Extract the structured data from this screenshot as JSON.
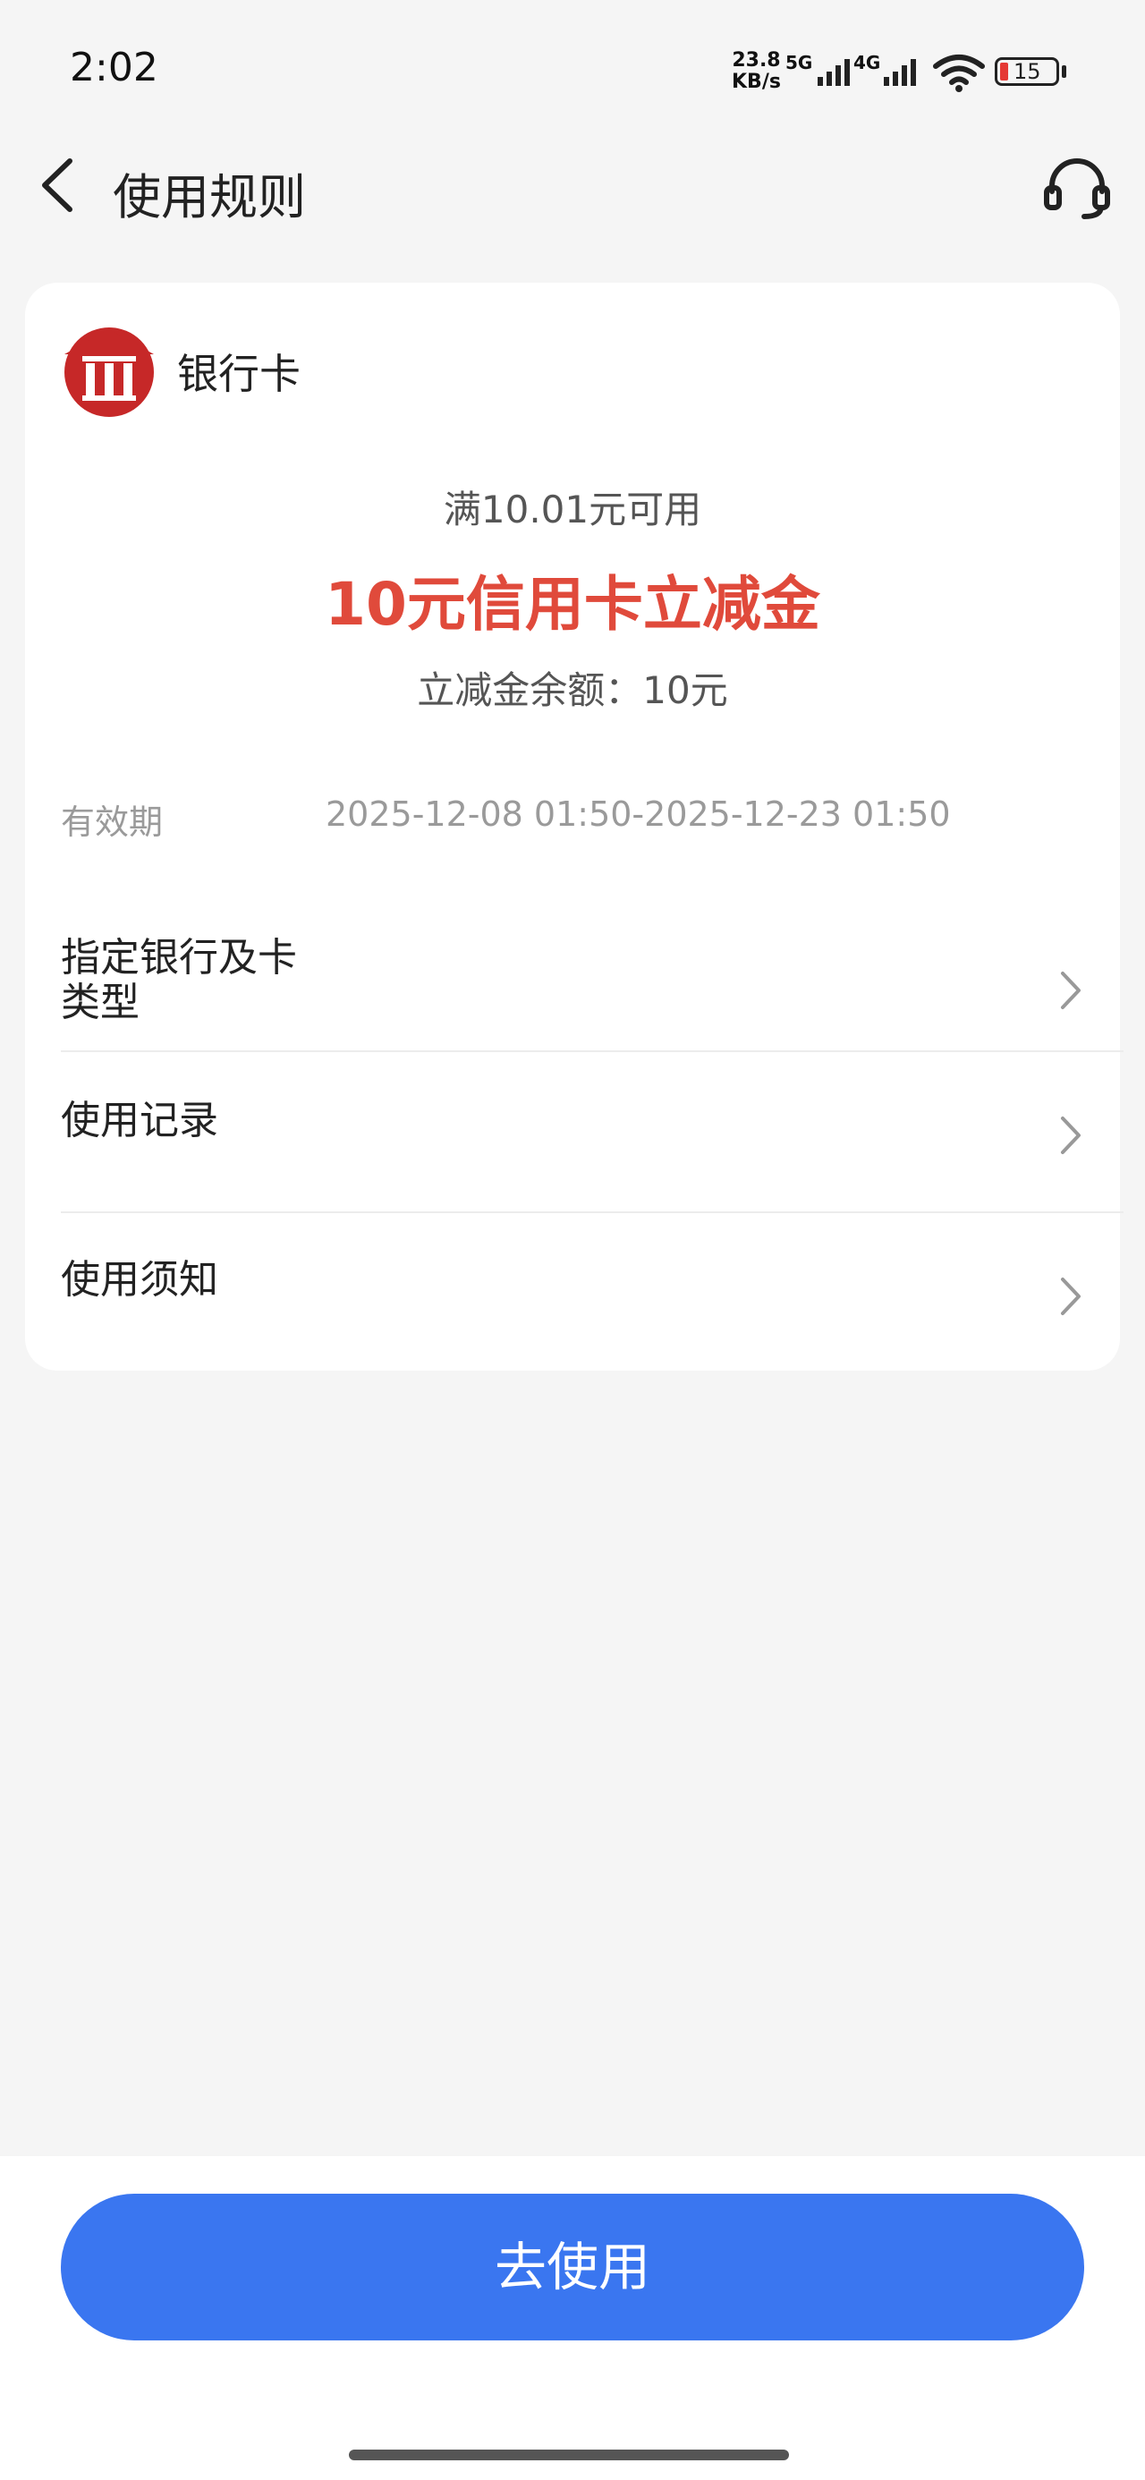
{
  "status_bar": {
    "time": "2:02",
    "net_speed_value": "23.8",
    "net_speed_unit": "KB/s",
    "signal1_tag": "5G",
    "signal2_tag": "4G",
    "battery_level": "15",
    "battery_color": "#e53935"
  },
  "nav": {
    "title": "使用规则",
    "back_icon": "chevron-left-icon",
    "support_icon": "headset-icon"
  },
  "card": {
    "bank_name": "银行卡",
    "bank_logo_color": "#c62828",
    "threshold": "满10.01元可用",
    "coupon_title": "10元信用卡立减金",
    "coupon_title_color": "#e04a3b",
    "balance": "立减金余额：10元",
    "validity_label": "有效期",
    "validity_value": "2025-12-08 01:50-2025-12-23 01:50",
    "menu": [
      {
        "label_line1": "指定银行及卡",
        "label_line2": "类型"
      },
      {
        "label": "使用记录"
      },
      {
        "label": "使用须知"
      }
    ]
  },
  "footer": {
    "button_label": "去使用",
    "button_color": "#3a76f0"
  }
}
